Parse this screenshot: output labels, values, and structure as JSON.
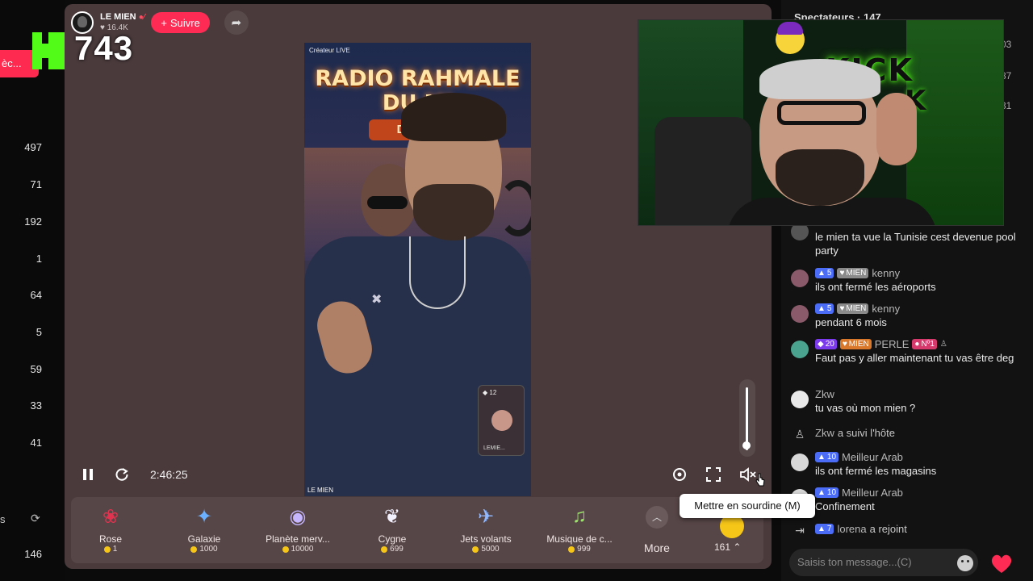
{
  "left": {
    "tag_text": "èc...",
    "viewer_count": "743",
    "numbers": [
      "497",
      "71",
      "192",
      "1",
      "64",
      "5",
      "59",
      "33",
      "41"
    ],
    "bottom_s": "s",
    "bottom_num": "146"
  },
  "host": {
    "name": "LE MIEN",
    "likes": "16.4K",
    "follow_label": "Suivre"
  },
  "video": {
    "createur_label": "Créateur LIVE",
    "title_line1": "RADIO RAHMALE",
    "title_line2": "DU MI",
    "subtitle": "De 18H",
    "watermark": "LE MIEN",
    "pip_count": "12",
    "pip_name": "LEMIE..."
  },
  "controls": {
    "time": "2:46:25",
    "tooltip": "Mettre en sourdine (M)",
    "volume_level": 0.05
  },
  "gifts": [
    {
      "name": "Rose",
      "price": "1",
      "icon": "rose-icon",
      "color": "#e0334f",
      "glyph": "❀"
    },
    {
      "name": "Galaxie",
      "price": "1000",
      "icon": "galaxy-icon",
      "color": "#6ab0ff",
      "glyph": "✦"
    },
    {
      "name": "Planète merv...",
      "price": "10000",
      "icon": "planet-icon",
      "color": "#c5b6ff",
      "glyph": "◉"
    },
    {
      "name": "Cygne",
      "price": "699",
      "icon": "swan-icon",
      "color": "#f2f2ff",
      "glyph": "❦"
    },
    {
      "name": "Jets volants",
      "price": "5000",
      "icon": "jets-icon",
      "color": "#8fb8ff",
      "glyph": "✈"
    },
    {
      "name": "Musique de c...",
      "price": "999",
      "icon": "music-icon",
      "color": "#9be36a",
      "glyph": "♫"
    }
  ],
  "gift_more": {
    "label": "More",
    "coin_count": "161"
  },
  "chat": {
    "header": "Spectateurs · 147",
    "right_numbers": [
      "03",
      "87",
      "31"
    ],
    "messages": [
      {
        "text": "le mien ta vue la Tunisie cest devenue pool party"
      },
      {
        "level": "5",
        "club": "MIEN",
        "user": "kenny",
        "text": "ils ont fermé les aéroports"
      },
      {
        "level": "5",
        "club": "MIEN",
        "user": "kenny",
        "text": "pendant 6 mois"
      },
      {
        "level": "20",
        "club": "MIEN",
        "user": "PERLE",
        "rank": "Nº1",
        "text": "Faut pas y aller maintenant tu vas être deg"
      },
      {
        "user": "Zkw",
        "text": "tu vas où mon mien ?"
      },
      {
        "user": "Zkw",
        "text": "a suivi l'hôte"
      },
      {
        "level": "10",
        "user": "Meilleur Arab",
        "text": "ils ont fermé les magasins"
      },
      {
        "level": "10",
        "user": "Meilleur Arab",
        "text": "Confinement"
      },
      {
        "level": "7",
        "user": "lorena",
        "text": "a rejoint"
      }
    ],
    "input_placeholder": "Saisis ton message...(C)"
  },
  "colors": {
    "accent": "#fe2c55",
    "kick_green": "#53fc18",
    "panel": "#4a3a3c",
    "coin": "#f5c518"
  }
}
